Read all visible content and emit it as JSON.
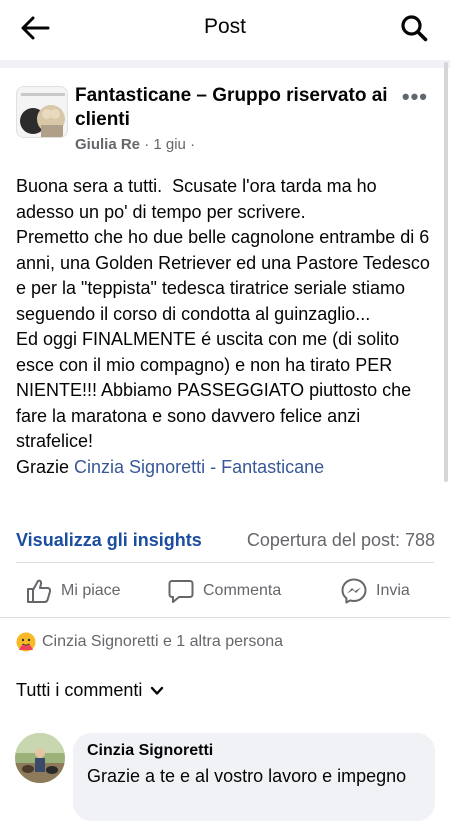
{
  "header": {
    "title": "Post"
  },
  "post": {
    "group_name": "Fantasticane – Gruppo riservato ai clienti",
    "author": "Giulia Re",
    "time": "1 giu",
    "meta_separator": "·",
    "body": "Buona sera a tutti.  Scusate l'ora tarda ma ho adesso un po' di tempo per scrivere.\nPremetto che ho due belle cagnolone entrambe di 6 anni, una Golden Retriever ed una Pastore Tedesco  e per la \"teppista\" tedesca tiratrice seriale stiamo seguendo il corso di condotta al guinzaglio...\nEd oggi FINALMENTE é uscita con me (di solito esce con il mio compagno) e non ha tirato PER NIENTE!!! Abbiamo PASSEGGIATO piuttosto che fare la maratona e sono davvero felice anzi strafelice!\nGrazie ",
    "mention": "Cinzia Signoretti - Fantasticane"
  },
  "insights": {
    "link_label": "Visualizza gli insights",
    "reach_label": "Copertura del post: 788"
  },
  "actions": {
    "like": "Mi piace",
    "comment": "Commenta",
    "share": "Invia"
  },
  "reactions": {
    "text": "Cinzia Signoretti e 1 altra persona"
  },
  "comments": {
    "filter_label": "Tutti i commenti",
    "items": [
      {
        "author": "Cinzia Signoretti",
        "text": "Grazie a te e al vostro lavoro e impegno"
      }
    ]
  },
  "icons": {
    "back": "back-arrow-icon",
    "search": "search-icon",
    "more": "more-options-icon",
    "like": "thumbs-up-icon",
    "comment": "comment-bubble-icon",
    "share": "messenger-icon",
    "reaction": "care-reaction-icon",
    "filter": "chevron-down-icon"
  },
  "colors": {
    "link_blue": "#1b4ea1",
    "mention_blue": "#385898",
    "secondary_text": "#65676b",
    "bubble_bg": "#f0f2f5"
  }
}
